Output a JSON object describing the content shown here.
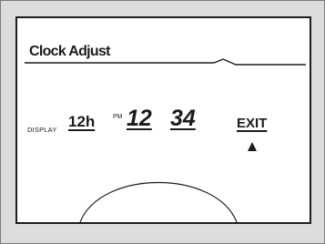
{
  "screen": {
    "title": "Clock Adjust"
  },
  "settings": {
    "display_label": "DISPLAY",
    "format_value": "12h",
    "ampm": "PM",
    "hours": "12",
    "minutes": "34",
    "exit_label": "EXIT"
  },
  "icons": {
    "pointer": "up-triangle-icon",
    "dial": "dial-knob-arc"
  },
  "colors": {
    "frame_bg": "#dcdcdc",
    "screen_bg": "#ffffff",
    "ink": "#1c1c1c"
  }
}
